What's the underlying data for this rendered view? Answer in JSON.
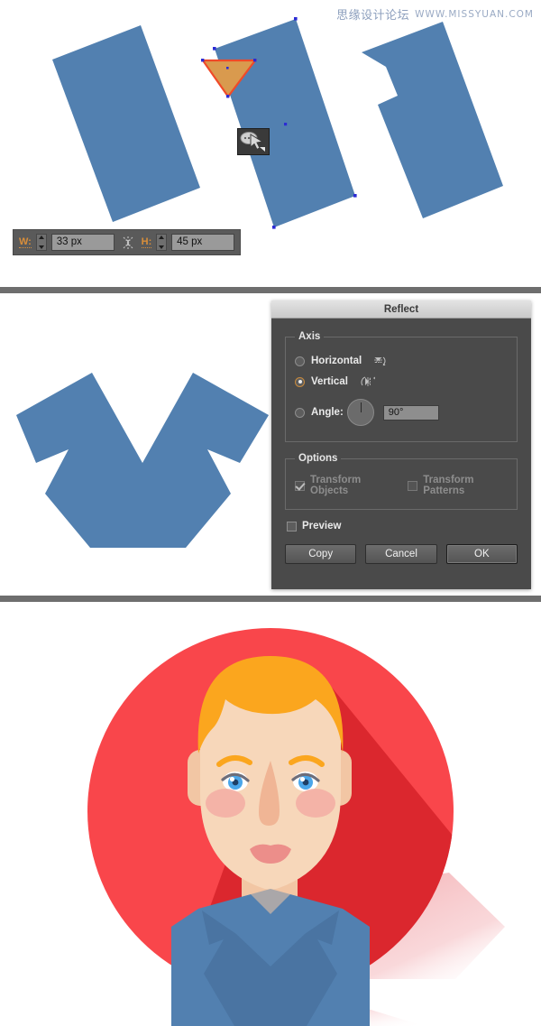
{
  "watermark": {
    "cn": "思缘设计论坛",
    "url": "WWW.MISSYUAN.COM"
  },
  "panel_shapes": {
    "name": "Illustrator artboard with three rotated blue shapes",
    "shape_fill": "#5280b0",
    "highlight_fill": "#d99a4e",
    "highlight_stroke": "#f04a28",
    "anchor_color": "#2b2bd4",
    "cursor_tool": "shape-builder-cursor",
    "measure_bar": {
      "width_label": "W:",
      "width_value": "33 px",
      "height_label": "H:",
      "height_value": "45 px",
      "link_icon": "constrain-proportions-icon"
    }
  },
  "reflect_dialog": {
    "title": "Reflect",
    "axis": {
      "legend": "Axis",
      "options": [
        {
          "label": "Horizontal",
          "selected": false,
          "icon": "reflect-horizontal-icon"
        },
        {
          "label": "Vertical",
          "selected": true,
          "icon": "reflect-vertical-icon"
        }
      ],
      "angle": {
        "label": "Angle:",
        "value": "90°",
        "selected": false,
        "dial": "angle-dial"
      }
    },
    "options": {
      "legend": "Options",
      "transform_objects": {
        "label": "Transform Objects",
        "checked": true,
        "disabled": true
      },
      "transform_patterns": {
        "label": "Transform Patterns",
        "checked": false,
        "disabled": true
      }
    },
    "preview": {
      "label": "Preview",
      "checked": false
    },
    "buttons": [
      {
        "label": "Copy",
        "primary": false
      },
      {
        "label": "Cancel",
        "primary": false
      },
      {
        "label": "OK",
        "primary": true
      }
    ]
  },
  "panel_vshape": {
    "name": "Merged V-shaped collar silhouette",
    "fill": "#5280b0"
  },
  "panel_avatar": {
    "name": "Flat-design circular avatar of a blond man",
    "colors": {
      "circle": "#f9464b",
      "long_shadow": "#d8252b",
      "hair": "#fba61e",
      "skin": "#f7d7ba",
      "skin_shadow": "#f2c6a4",
      "nose": "#f0b595",
      "cheek": "#f2aaa2",
      "lips": "#ec8e8a",
      "eye_white": "#ffffff",
      "iris": "#4aa6ea",
      "eyebrow": "#fba61e",
      "eyelid": "#6e6e7a",
      "shirt": "#5280b0",
      "shirt_shadow": "#4a74a2",
      "collar": "#4a74a2"
    }
  },
  "dividers": {
    "color": "#6e6e6e"
  }
}
